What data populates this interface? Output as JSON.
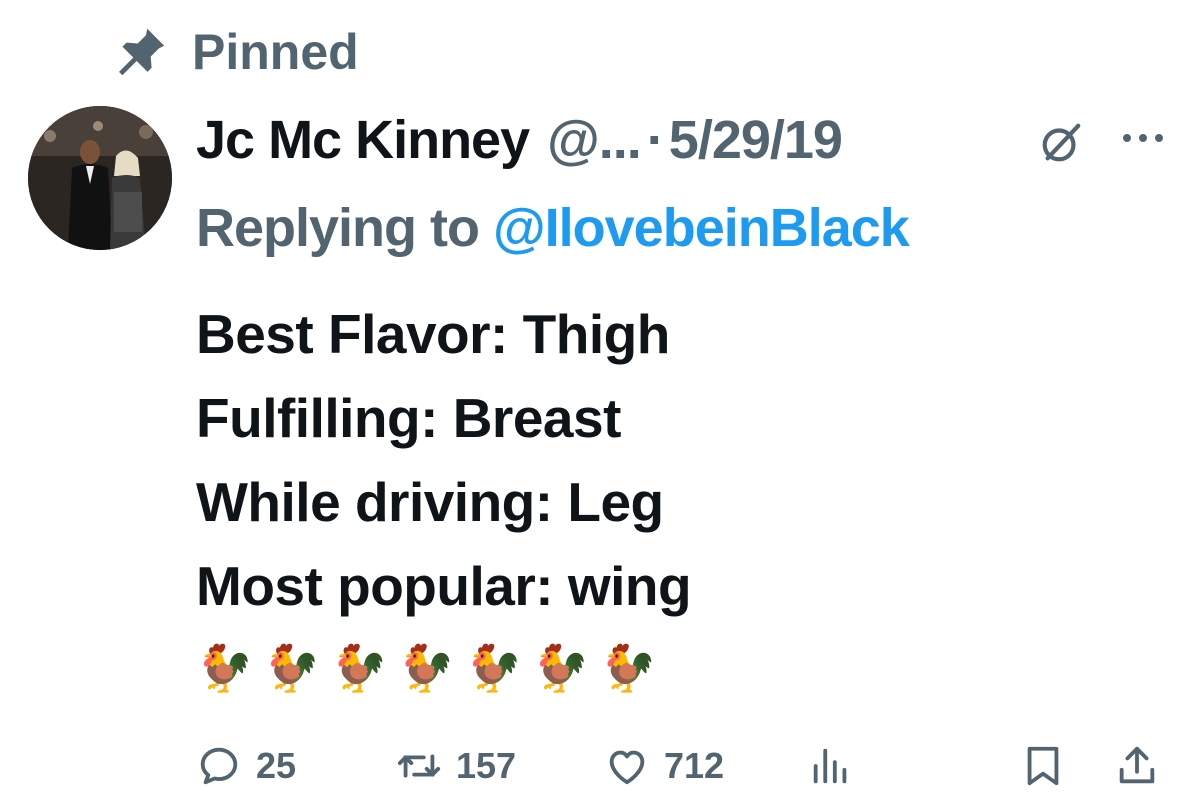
{
  "pinned": {
    "label": "Pinned",
    "icon": "pin-icon"
  },
  "tweet": {
    "author": {
      "display_name": "Jc Mc Kinney",
      "handle": "@...",
      "avatar_icon": "avatar"
    },
    "separator": "·",
    "date": "5/29/19",
    "reply": {
      "prefix": "Replying to",
      "handle": "@IlovebeinBlack"
    },
    "lines": [
      "Best Flavor: Thigh",
      "Fulfilling: Breast",
      "While driving: Leg",
      "Most popular: wing"
    ],
    "emoji_line": "🐓🐓🐓🐓🐓🐓🐓"
  },
  "actions": {
    "replies": "25",
    "reposts": "157",
    "likes": "712"
  },
  "colors": {
    "text": "#0f1419",
    "secondary": "#536471",
    "link": "#1d9bf0"
  }
}
